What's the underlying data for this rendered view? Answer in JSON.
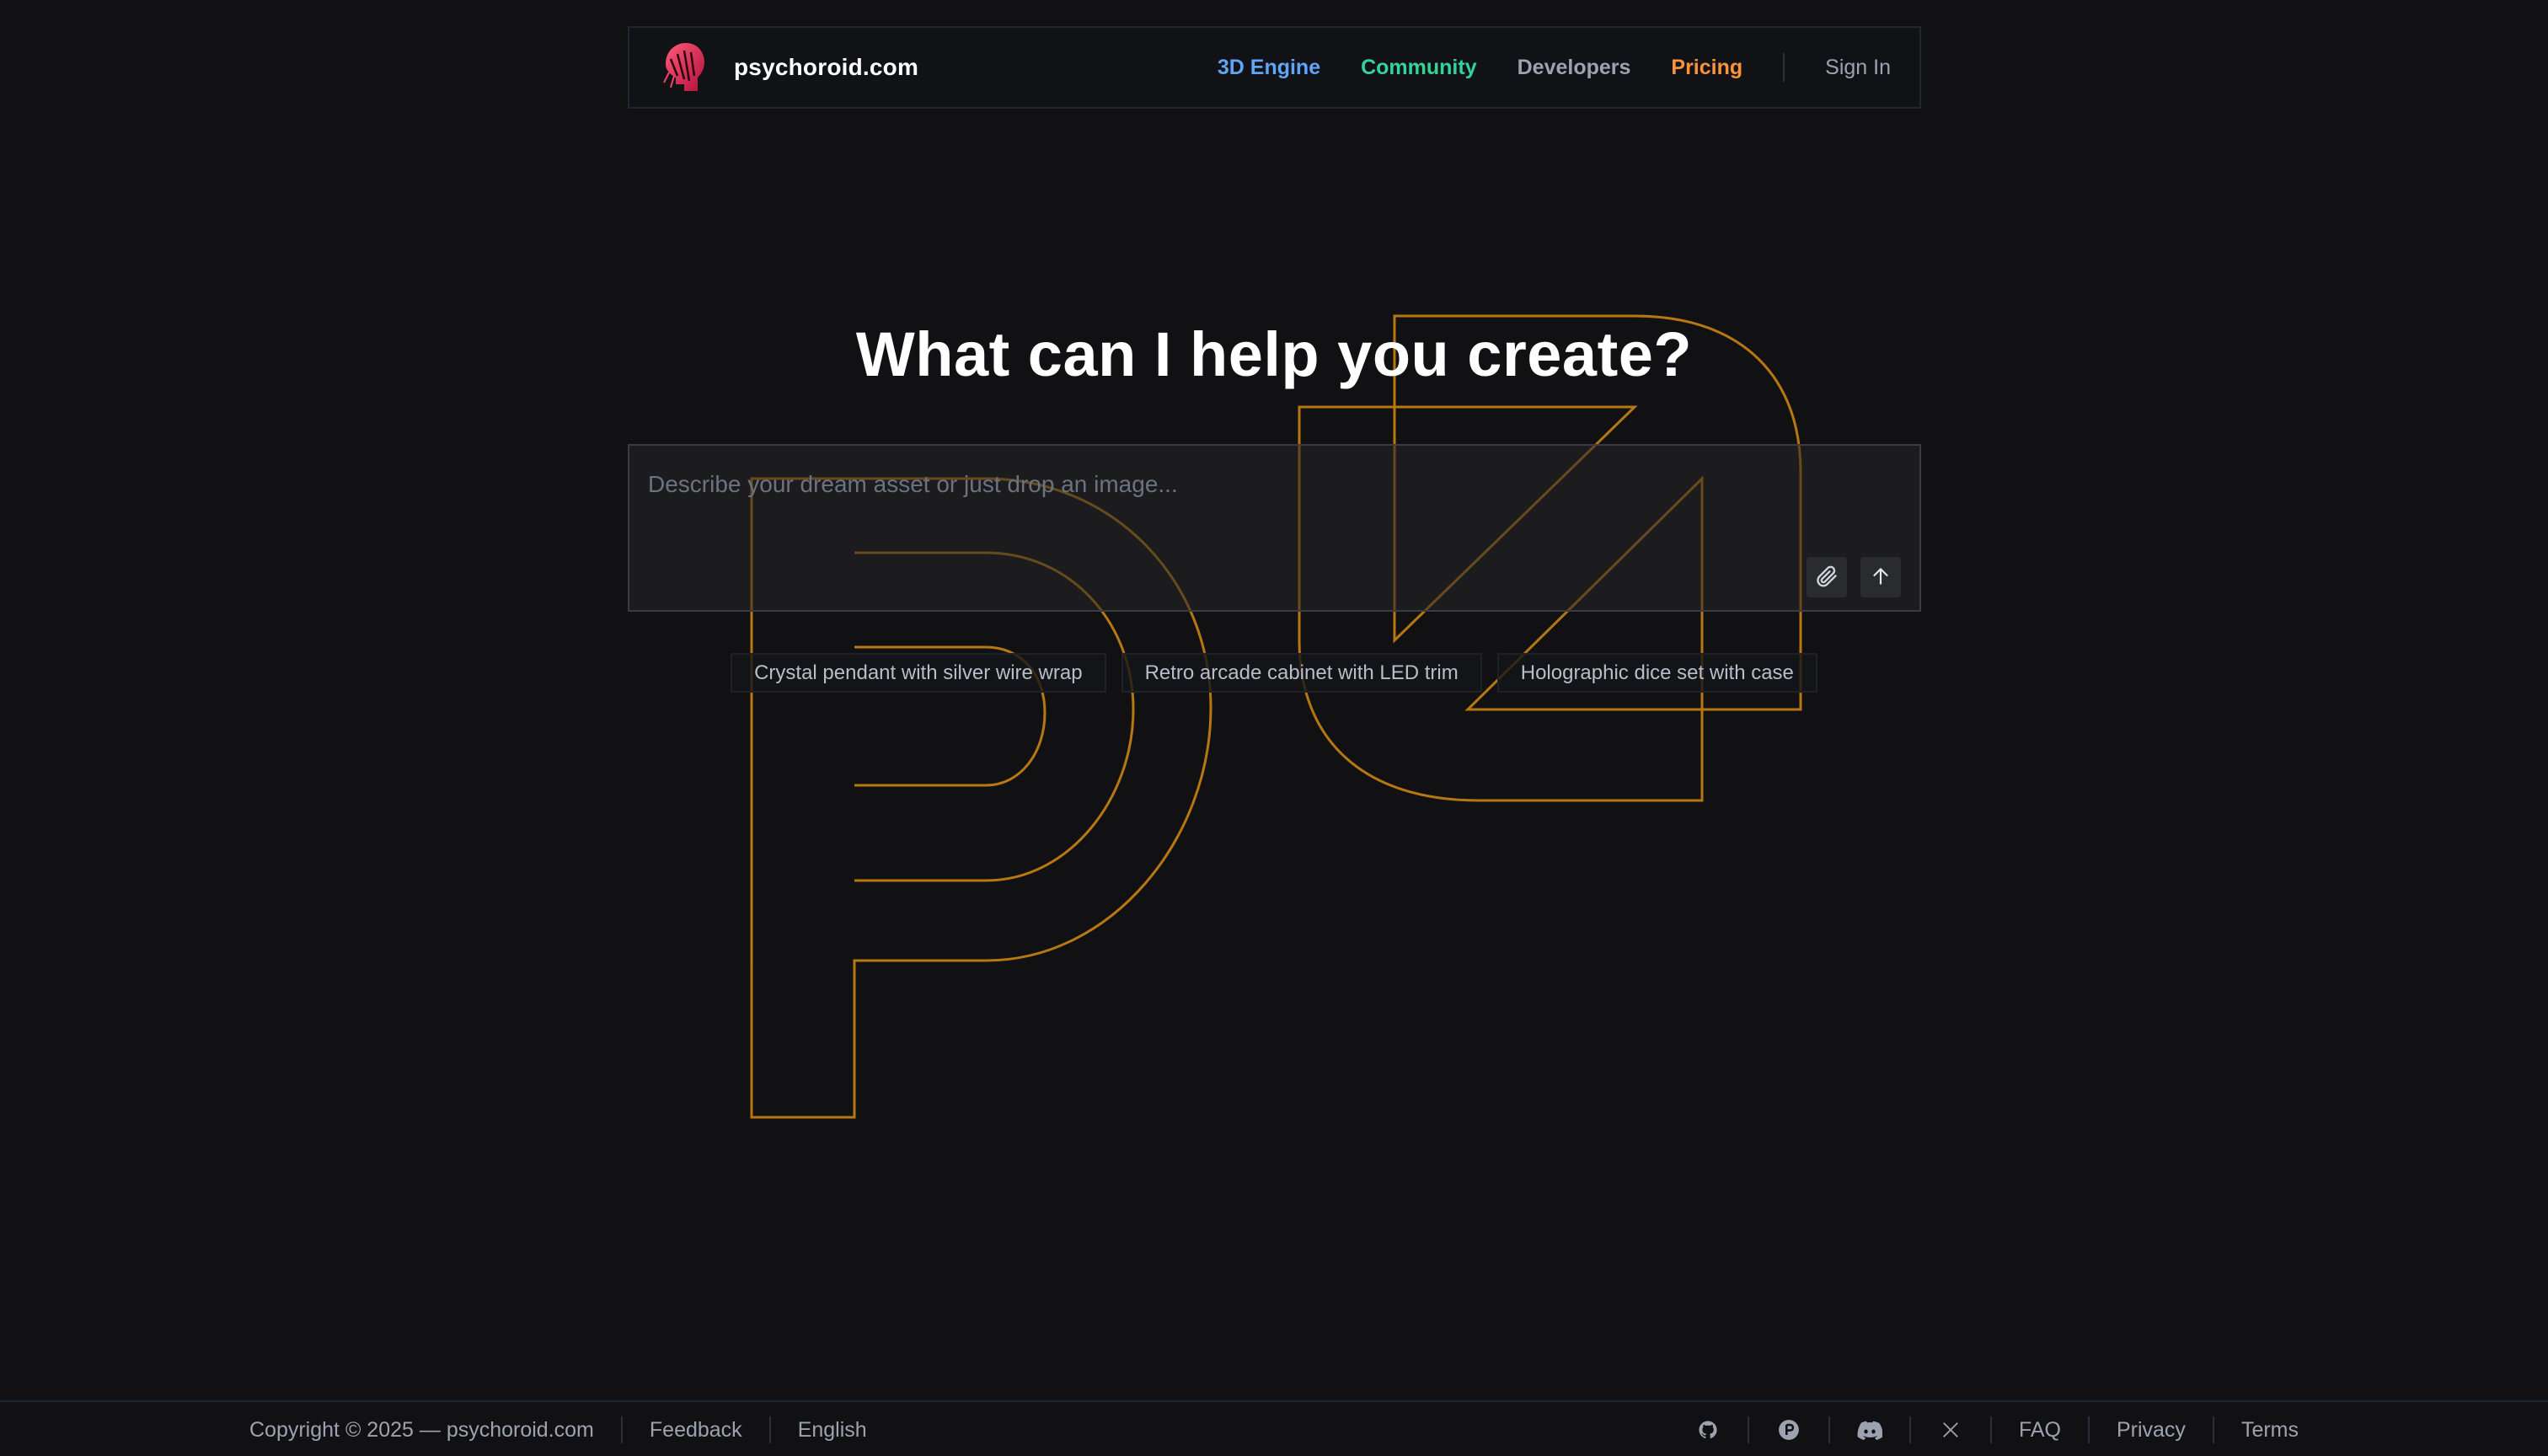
{
  "header": {
    "brand_name": "psychoroid.com",
    "nav": {
      "engine": "3D Engine",
      "community": "Community",
      "developers": "Developers",
      "pricing": "Pricing",
      "signin": "Sign In"
    }
  },
  "hero": {
    "title": "What can I help you create?",
    "placeholder": "Describe your dream asset or just drop an image..."
  },
  "suggestions": [
    "Crystal pendant with silver wire wrap",
    "Retro arcade cabinet with LED trim",
    "Holographic dice set with case"
  ],
  "footer": {
    "copyright": "Copyright © 2025 — psychoroid.com",
    "feedback": "Feedback",
    "language": "English",
    "faq": "FAQ",
    "privacy": "Privacy",
    "terms": "Terms",
    "icons": [
      "github-icon",
      "producthunt-icon",
      "discord-icon",
      "x-icon"
    ]
  },
  "colors": {
    "background": "#111114",
    "engine": "#60a5fa",
    "community": "#34d399",
    "pricing": "#fb923c",
    "outline": "#d48a12"
  }
}
